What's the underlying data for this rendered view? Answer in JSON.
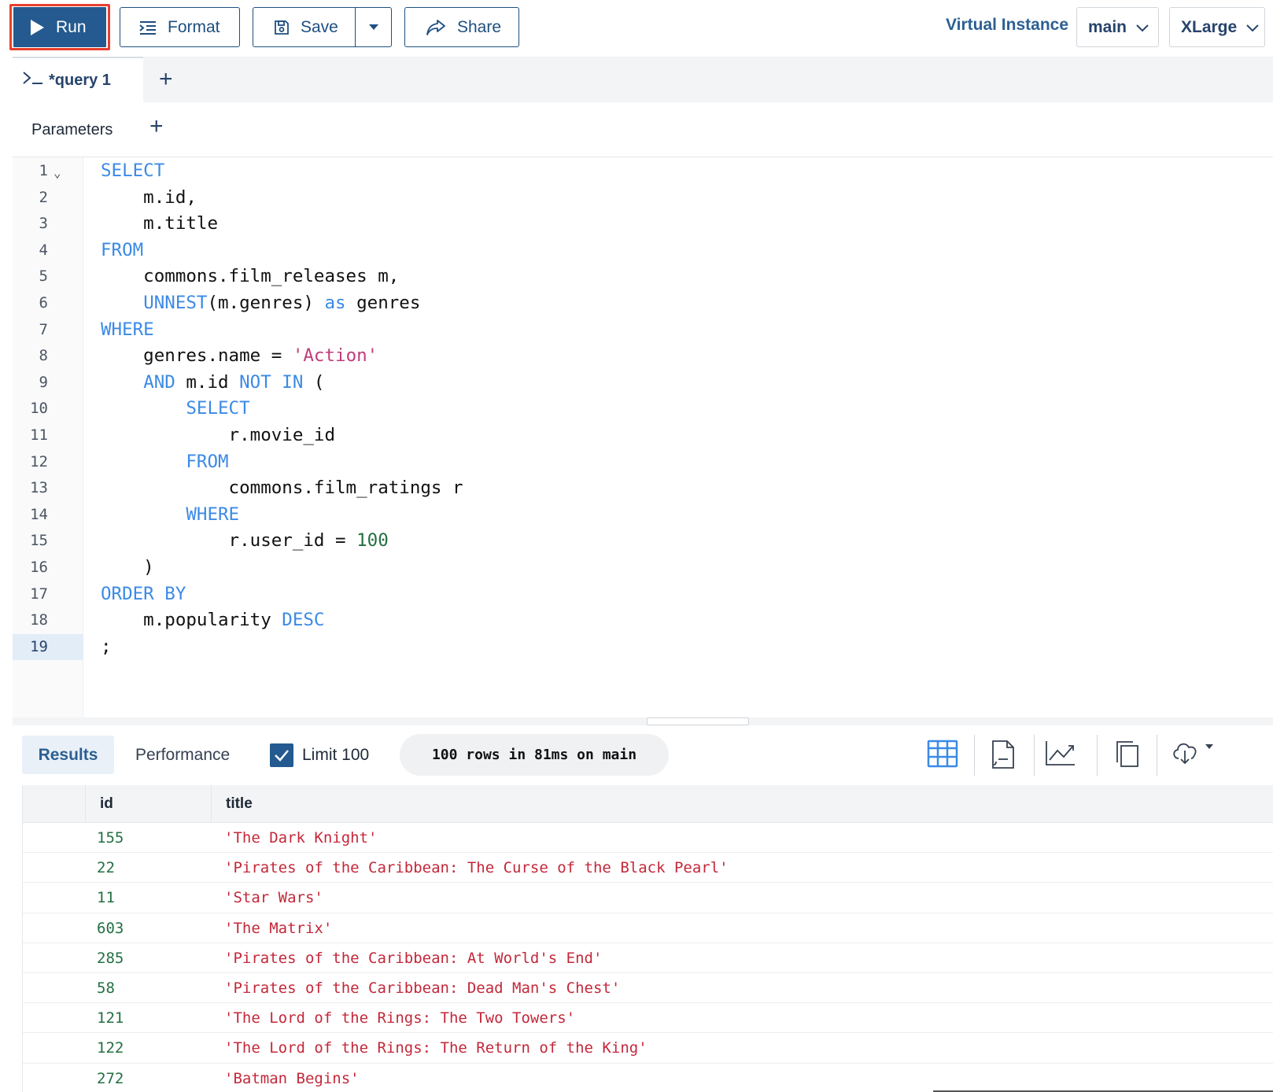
{
  "toolbar": {
    "run_label": "Run",
    "format_label": "Format",
    "save_label": "Save",
    "share_label": "Share",
    "virtual_instance_label": "Virtual Instance",
    "instance_value": "main",
    "size_value": "XLarge"
  },
  "tabs": [
    {
      "label": "*query 1",
      "active": true
    }
  ],
  "parameters": {
    "label": "Parameters"
  },
  "editor": {
    "current_line": 19,
    "lines": [
      {
        "n": "1",
        "fold": true
      },
      {
        "n": "2"
      },
      {
        "n": "3"
      },
      {
        "n": "4"
      },
      {
        "n": "5"
      },
      {
        "n": "6"
      },
      {
        "n": "7"
      },
      {
        "n": "8"
      },
      {
        "n": "9"
      },
      {
        "n": "10"
      },
      {
        "n": "11"
      },
      {
        "n": "12"
      },
      {
        "n": "13"
      },
      {
        "n": "14"
      },
      {
        "n": "15"
      },
      {
        "n": "16"
      },
      {
        "n": "17"
      },
      {
        "n": "18"
      },
      {
        "n": "19"
      }
    ],
    "code": [
      [
        [
          "kw",
          "SELECT"
        ]
      ],
      [
        [
          "t",
          "    m.id,"
        ]
      ],
      [
        [
          "t",
          "    m.title"
        ]
      ],
      [
        [
          "kw",
          "FROM"
        ]
      ],
      [
        [
          "t",
          "    commons.film_releases m,"
        ]
      ],
      [
        [
          "t",
          "    "
        ],
        [
          "kw",
          "UNNEST"
        ],
        [
          "t",
          "(m.genres) "
        ],
        [
          "kw",
          "as"
        ],
        [
          "t",
          " genres"
        ]
      ],
      [
        [
          "kw",
          "WHERE"
        ]
      ],
      [
        [
          "t",
          "    genres.name = "
        ],
        [
          "str",
          "'Action'"
        ]
      ],
      [
        [
          "t",
          "    "
        ],
        [
          "kw",
          "AND"
        ],
        [
          "t",
          " m.id "
        ],
        [
          "kw",
          "NOT"
        ],
        [
          "t",
          " "
        ],
        [
          "kw",
          "IN"
        ],
        [
          "t",
          " ("
        ]
      ],
      [
        [
          "t",
          "        "
        ],
        [
          "kw",
          "SELECT"
        ]
      ],
      [
        [
          "t",
          "            r.movie_id"
        ]
      ],
      [
        [
          "t",
          "        "
        ],
        [
          "kw",
          "FROM"
        ]
      ],
      [
        [
          "t",
          "            commons.film_ratings r"
        ]
      ],
      [
        [
          "t",
          "        "
        ],
        [
          "kw",
          "WHERE"
        ]
      ],
      [
        [
          "t",
          "            r.user_id = "
        ],
        [
          "num",
          "100"
        ]
      ],
      [
        [
          "t",
          "    )"
        ]
      ],
      [
        [
          "kw",
          "ORDER BY"
        ]
      ],
      [
        [
          "t",
          "    m.popularity "
        ],
        [
          "kw",
          "DESC"
        ]
      ],
      [
        [
          "t",
          ";"
        ]
      ]
    ]
  },
  "results": {
    "tab_results": "Results",
    "tab_performance": "Performance",
    "limit_label": "Limit 100",
    "limit_checked": true,
    "status": "100 rows in 81ms on main",
    "columns": [
      "id",
      "title"
    ],
    "rows": [
      [
        "155",
        "'The Dark Knight'"
      ],
      [
        "22",
        "'Pirates of the Caribbean: The Curse of the Black Pearl'"
      ],
      [
        "11",
        "'Star Wars'"
      ],
      [
        "603",
        "'The Matrix'"
      ],
      [
        "285",
        "'Pirates of the Caribbean: At World's End'"
      ],
      [
        "58",
        "'Pirates of the Caribbean: Dead Man's Chest'"
      ],
      [
        "121",
        "'The Lord of the Rings: The Two Towers'"
      ],
      [
        "122",
        "'The Lord of the Rings: The Return of the King'"
      ],
      [
        "272",
        "'Batman Begins'"
      ]
    ],
    "view_icons": [
      "table-view-icon",
      "json-view-icon",
      "chart-view-icon",
      "copy-icon",
      "download-icon"
    ]
  },
  "colors": {
    "run_bg": "#245a8f",
    "run_outline": "#e8402e",
    "keyword": "#3b8ae6",
    "string": "#c03c7a",
    "number": "#237042",
    "result_string": "#c4283a"
  }
}
